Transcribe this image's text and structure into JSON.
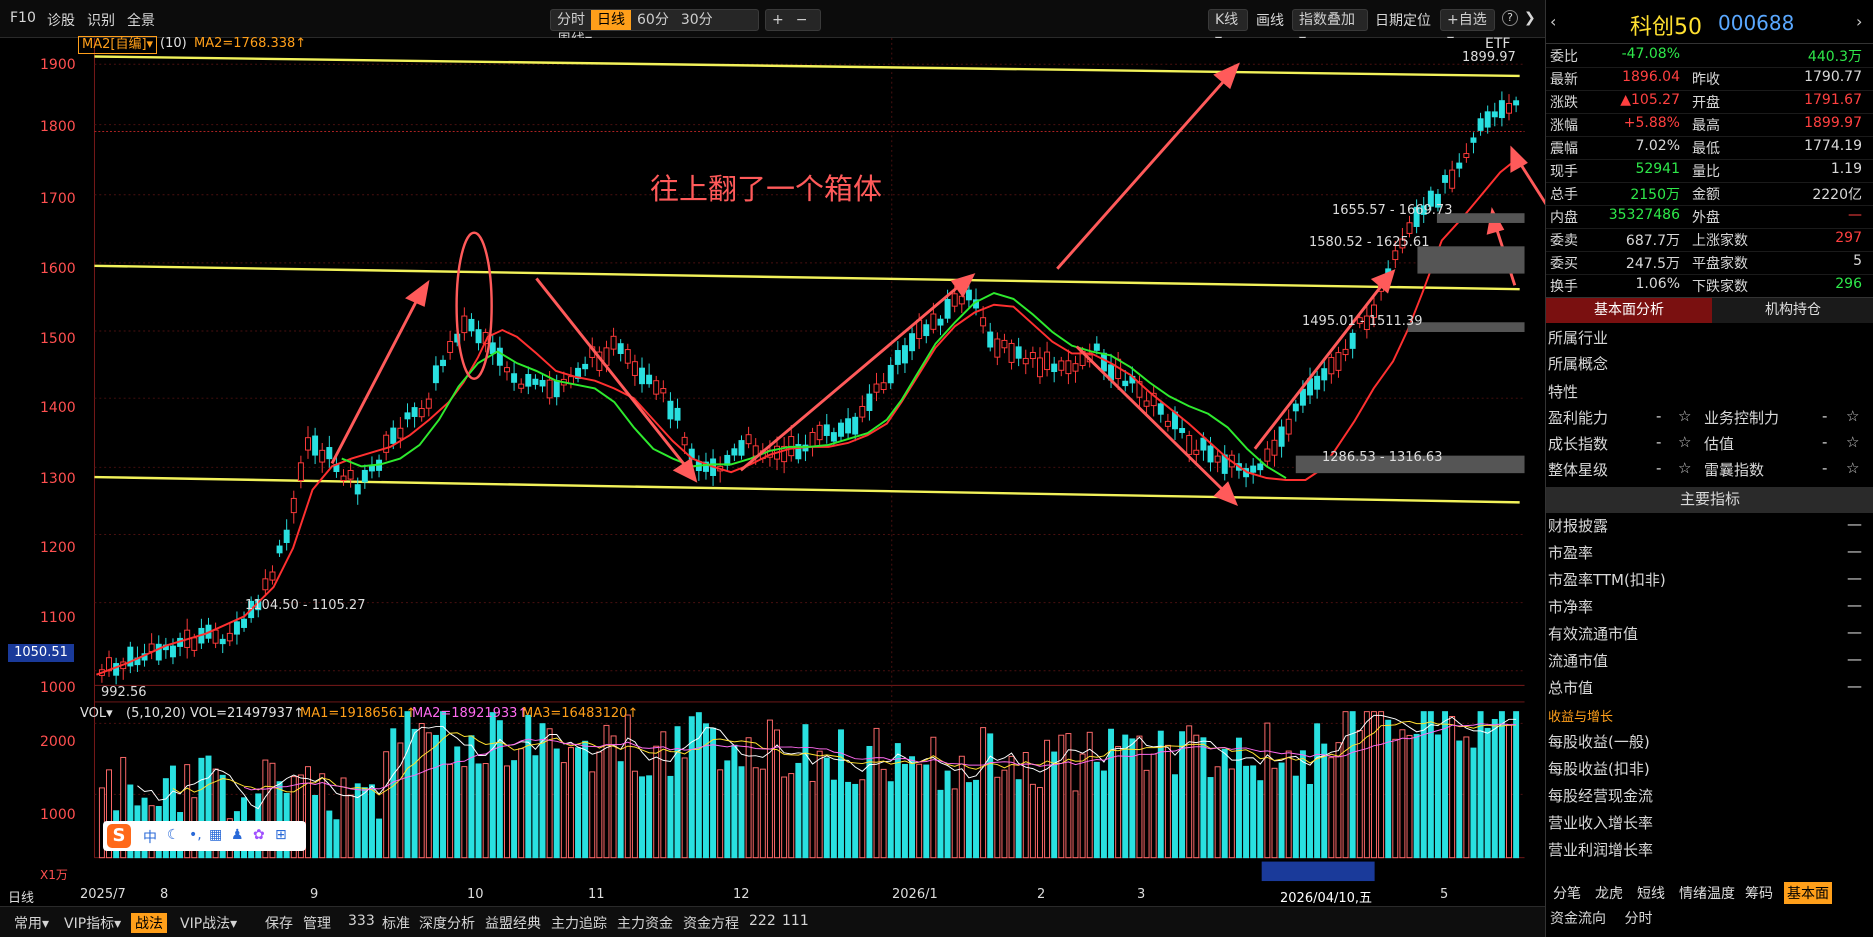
{
  "toolbar": {
    "left": [
      "F10",
      "诊股",
      "识别",
      "全景"
    ],
    "periods": [
      "分时",
      "日线",
      "60分",
      "30分",
      "周线▾"
    ],
    "active_period": "日线",
    "zoom": [
      "+",
      "−"
    ],
    "right": [
      "K线▾",
      "画线",
      "指数叠加▾",
      "日期定位",
      "+自选▾",
      "?",
      "❯"
    ]
  },
  "ma_legend": {
    "box": "MA2[自编]▾",
    "period": "(10)",
    "value": "MA2=1768.338↑"
  },
  "etf": "ETF",
  "price_axis": [
    "1900",
    "1800",
    "1700",
    "1600",
    "1500",
    "1400",
    "1300",
    "1200",
    "1100",
    "1000"
  ],
  "current_price_tag": "1050.51",
  "price_labels": {
    "high": "1899.97",
    "low": "992.56",
    "l1": "1104.50 - 1105.27",
    "l2": "1286.53 - 1316.63",
    "l3": "1495.01 - 1511.39",
    "l4": "1580.52 - 1625.61",
    "l5": "1655.57 - 1669.73"
  },
  "annotation": "往上翻了一个箱体",
  "vol_legend": {
    "name": "VOL▾",
    "params": "(5,10,20)",
    "vol": "VOL=21497937↑",
    "ma1": "MA1=19186561↑",
    "ma2": "MA2=18921933↑",
    "ma3": "MA3=16483120↑"
  },
  "vol_axis": [
    "2000",
    "1000"
  ],
  "vol_unit": "X1万",
  "date_axis": {
    "label": "日线",
    "dates": [
      "2025/7",
      "8",
      "9",
      "10",
      "11",
      "12",
      "2026/1",
      "2",
      "3",
      "4",
      "5"
    ],
    "cursor": "2026/04/10,五"
  },
  "bottom": [
    "常用▾",
    "VIP指标▾",
    "战法",
    "VIP战法▾",
    "保存",
    "管理",
    "333",
    "标准",
    "深度分析",
    "益盟经典",
    "主力追踪",
    "主力资金",
    "资金方程",
    "222",
    "111"
  ],
  "right_panel": {
    "name": "科创50",
    "code": "000688",
    "rows": [
      {
        "l": "委比",
        "v": "-47.08%",
        "vc": "#2ee84a",
        "r": "",
        "rv": "440.3万",
        "rc": "#2ee84a"
      },
      {
        "l": "最新",
        "v": "1896.04",
        "vc": "#ff4040",
        "r": "昨收",
        "rv": "1790.77",
        "rc": "#d8d8d8"
      },
      {
        "l": "涨跌",
        "v": "▲105.27",
        "vc": "#ff4040",
        "r": "开盘",
        "rv": "1791.67",
        "rc": "#ff4040"
      },
      {
        "l": "涨幅",
        "v": "+5.88%",
        "vc": "#ff4040",
        "r": "最高",
        "rv": "1899.97",
        "rc": "#ff4040"
      },
      {
        "l": "震幅",
        "v": "7.02%",
        "vc": "#d8d8d8",
        "r": "最低",
        "rv": "1774.19",
        "rc": "#d8d8d8"
      },
      {
        "l": "现手",
        "v": "52941",
        "vc": "#2ee84a",
        "r": "量比",
        "rv": "1.19",
        "rc": "#d8d8d8"
      },
      {
        "l": "总手",
        "v": "2150万",
        "vc": "#2ee84a",
        "r": "金额",
        "rv": "2220亿",
        "rc": "#d8d8d8"
      },
      {
        "l": "内盘",
        "v": "35327486",
        "vc": "#2ee84a",
        "r": "外盘",
        "rv": "—",
        "rc": "#ff4040"
      },
      {
        "l": "委卖",
        "v": "687.7万",
        "vc": "#d8d8d8",
        "r": "上涨家数",
        "rv": "297",
        "rc": "#ff4040"
      },
      {
        "l": "委买",
        "v": "247.5万",
        "vc": "#d8d8d8",
        "r": "平盘家数",
        "rv": "5",
        "rc": "#d8d8d8"
      },
      {
        "l": "换手",
        "v": "1.06%",
        "vc": "#d8d8d8",
        "r": "下跌家数",
        "rv": "296",
        "rc": "#2ee84a"
      }
    ],
    "tab1": "基本面分析",
    "tab2": "机构持仓",
    "industry": "所属行业",
    "concept": "所属概念",
    "traits": "特性",
    "ratings": [
      [
        "盈利能力",
        "-",
        "业务控制力",
        "-"
      ],
      [
        "成长指数",
        "-",
        "估值",
        "-"
      ],
      [
        "整体星级",
        "-",
        "雷曩指数",
        "-"
      ]
    ],
    "main_ind": "主要指标",
    "indicators": [
      "财报披露",
      "市盈率",
      "市盈率TTM(扣非)",
      "市净率",
      "有效流通市值",
      "流通市值",
      "总市值"
    ],
    "growth_title": "收益与增长",
    "growth": [
      "每股收益(一般)",
      "每股收益(扣非)",
      "每股经营现金流",
      "营业收入增长率",
      "营业利润增长率"
    ],
    "bottom_tabs": [
      "分笔",
      "龙虎",
      "短线",
      "情绪温度",
      "筹码",
      "基本面"
    ],
    "bottom_tabs2": [
      "资金流向",
      "分时"
    ]
  }
}
